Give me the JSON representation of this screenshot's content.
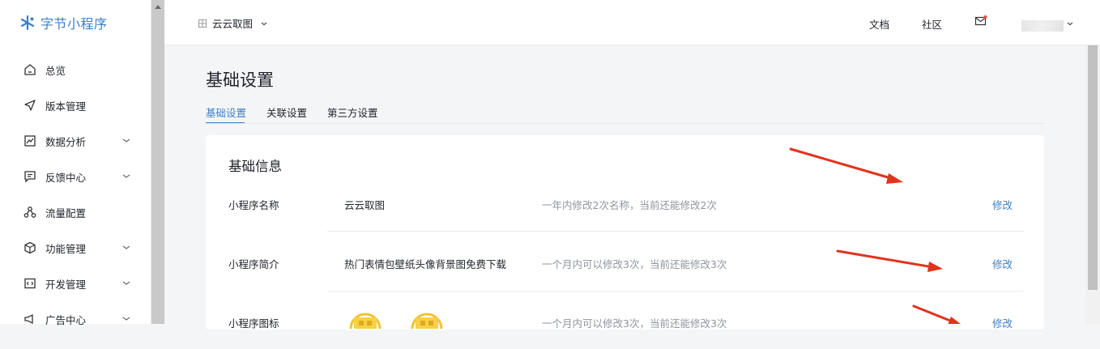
{
  "sidebar": {
    "logo_text": "字节小程序",
    "items": [
      {
        "label": "总览",
        "icon": "home-icon",
        "has_children": false
      },
      {
        "label": "版本管理",
        "icon": "send-icon",
        "has_children": false
      },
      {
        "label": "数据分析",
        "icon": "chart-icon",
        "has_children": true
      },
      {
        "label": "反馈中心",
        "icon": "message-icon",
        "has_children": true
      },
      {
        "label": "流量配置",
        "icon": "traffic-icon",
        "has_children": false
      },
      {
        "label": "功能管理",
        "icon": "cube-icon",
        "has_children": true
      },
      {
        "label": "开发管理",
        "icon": "code-icon",
        "has_children": true
      },
      {
        "label": "广告中心",
        "icon": "megaphone-icon",
        "has_children": true
      }
    ]
  },
  "topbar": {
    "app_name": "云云取图",
    "links": [
      "文档",
      "社区"
    ],
    "mail_icon": "mail-icon",
    "notification_dot_color": "#f54a45"
  },
  "page": {
    "title": "基础设置",
    "tabs": [
      {
        "label": "基础设置",
        "active": true
      },
      {
        "label": "关联设置",
        "active": false
      },
      {
        "label": "第三方设置",
        "active": false
      }
    ]
  },
  "card": {
    "title": "基础信息",
    "rows": [
      {
        "label": "小程序名称",
        "value": "云云取图",
        "hint": "一年内修改2次名称，当前还能修改2次",
        "action": "修改"
      },
      {
        "label": "小程序简介",
        "value": "热门表情包壁纸头像背景图免费下载",
        "hint": "一个月内可以修改3次，当前还能修改3次",
        "action": "修改"
      },
      {
        "label": "小程序图标",
        "value": "",
        "hint": "一个月内可以修改3次，当前还能修改3次",
        "action": "修改"
      }
    ]
  },
  "colors": {
    "accent": "#3c7fc4",
    "annotation_arrow": "#e0341e",
    "hint_text": "#8f959e"
  }
}
